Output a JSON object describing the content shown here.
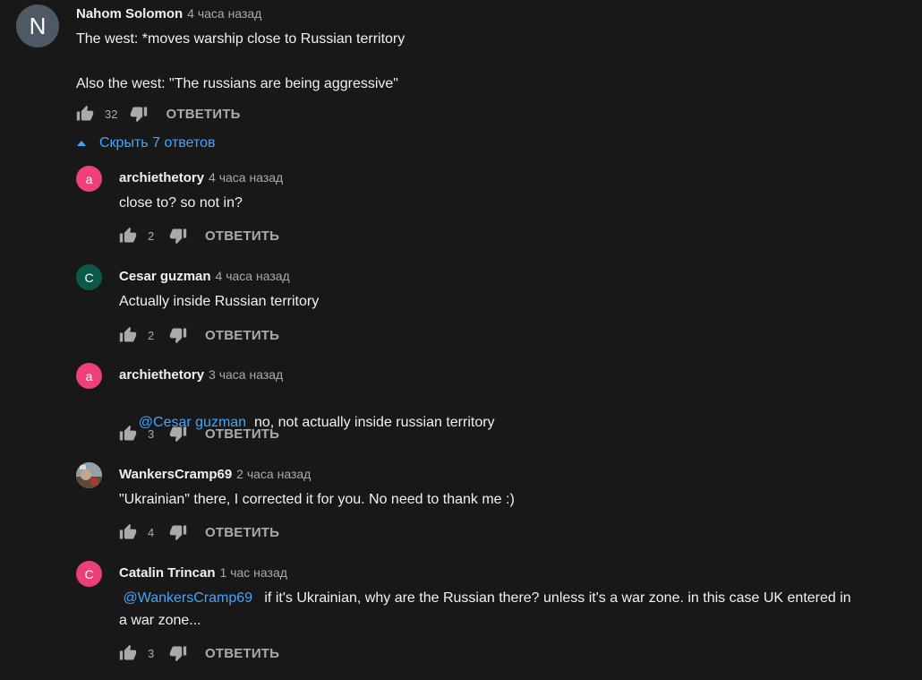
{
  "comment": {
    "avatar_letter": "N",
    "author": "Nahom Solomon",
    "time": "4 часа назад",
    "text": "The west: *moves warship close to Russian territory\n\nAlso the west: \"The russians are being aggressive\"",
    "likes": "32",
    "reply_label": "ОТВЕТИТЬ",
    "toggle_label": "Скрыть 7 ответов"
  },
  "replies": [
    {
      "avatar_letter": "a",
      "avatar_color": "#f0407a",
      "author": "archiethetory",
      "time": "4 часа назад",
      "text": "close to? so not in?",
      "likes": "2",
      "reply_label": "ОТВЕТИТЬ"
    },
    {
      "avatar_letter": "C",
      "avatar_color": "#0b5a48",
      "author": "Cesar guzman",
      "time": "4 часа назад",
      "text": "Actually inside Russian territory",
      "likes": "2",
      "reply_label": "ОТВЕТИТЬ"
    },
    {
      "avatar_letter": "a",
      "avatar_color": "#f0407a",
      "author": "archiethetory",
      "time": "3 часа назад",
      "mention": "@Cesar guzman",
      "text": "no, not actually inside russian territory",
      "likes": "3",
      "reply_label": "ОТВЕТИТЬ"
    },
    {
      "avatar_letter": "",
      "author": "WankersCramp69",
      "time": "2 часа назад",
      "text": "\"Ukrainian\" there, I corrected it for you. No need to thank me :)",
      "likes": "4",
      "reply_label": "ОТВЕТИТЬ"
    },
    {
      "avatar_letter": "C",
      "avatar_color": "#ec3f79",
      "author": "Catalin Trincan",
      "time": "1 час назад",
      "mention": "@WankersCramp69",
      "text": "if it's Ukrainian, why are the Russian there? unless it's a war zone. in this case UK entered in\na war zone...",
      "likes": "3",
      "reply_label": "ОТВЕТИТЬ"
    }
  ]
}
